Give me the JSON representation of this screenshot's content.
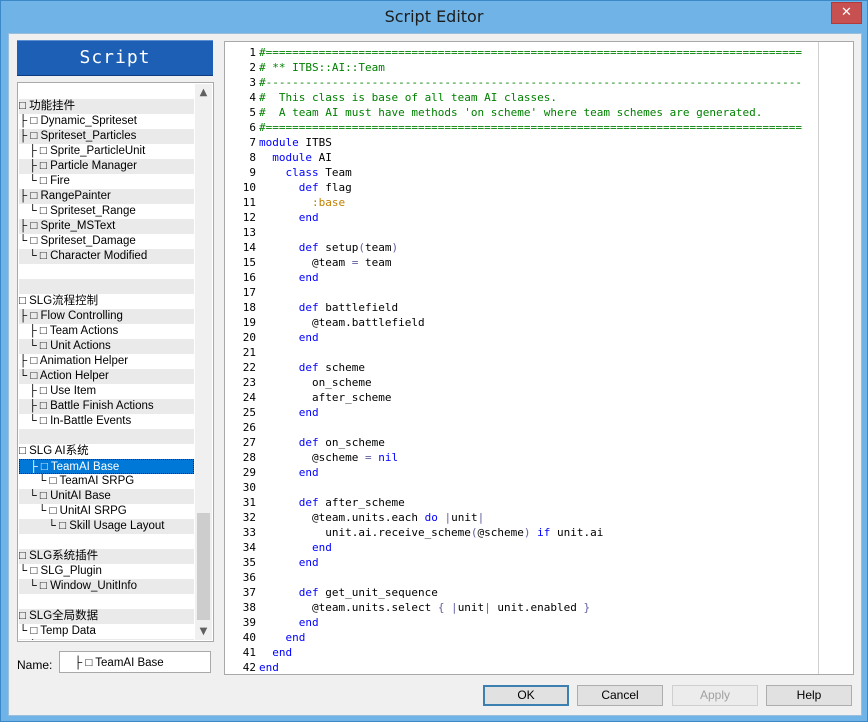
{
  "window": {
    "title": "Script Editor",
    "close_glyph": "✕"
  },
  "header": "Script",
  "script_list": [
    {
      "text": "",
      "shade": false
    },
    {
      "text": "□ 功能挂件",
      "shade": true
    },
    {
      "text": "├ □ Dynamic_Spriteset",
      "shade": false
    },
    {
      "text": "├ □ Spriteset_Particles",
      "shade": true
    },
    {
      "text": "   ├ □ Sprite_ParticleUnit",
      "shade": false
    },
    {
      "text": "   ├ □ Particle Manager",
      "shade": true
    },
    {
      "text": "   └ □ Fire",
      "shade": false
    },
    {
      "text": "├ □ RangePainter",
      "shade": true
    },
    {
      "text": "   └ □ Spriteset_Range",
      "shade": false
    },
    {
      "text": "├ □ Sprite_MSText",
      "shade": true
    },
    {
      "text": "└ □ Spriteset_Damage",
      "shade": false
    },
    {
      "text": "   └ □ Character Modified",
      "shade": true
    },
    {
      "text": "",
      "shade": false
    },
    {
      "text": "",
      "shade": true
    },
    {
      "text": "□ SLG流程控制",
      "shade": false
    },
    {
      "text": "├ □ Flow Controlling",
      "shade": true
    },
    {
      "text": "   ├ □ Team Actions",
      "shade": false
    },
    {
      "text": "   └ □ Unit Actions",
      "shade": true
    },
    {
      "text": "├ □ Animation Helper",
      "shade": false
    },
    {
      "text": "└ □ Action Helper",
      "shade": true
    },
    {
      "text": "   ├ □ Use Item",
      "shade": false
    },
    {
      "text": "   ├ □ Battle Finish Actions",
      "shade": true
    },
    {
      "text": "   └ □ In-Battle Events",
      "shade": false
    },
    {
      "text": "",
      "shade": true
    },
    {
      "text": "□ SLG AI系统",
      "shade": false
    },
    {
      "text": "   ├ □ TeamAI Base",
      "shade": true,
      "selected": true
    },
    {
      "text": "      └ □ TeamAI SRPG",
      "shade": false
    },
    {
      "text": "   └ □ UnitAI Base",
      "shade": true
    },
    {
      "text": "      └ □ UnitAI SRPG",
      "shade": false
    },
    {
      "text": "         └ □ Skill Usage Layout",
      "shade": true
    },
    {
      "text": "",
      "shade": false
    },
    {
      "text": "□ SLG系统插件",
      "shade": true
    },
    {
      "text": "└ □ SLG_Plugin",
      "shade": false
    },
    {
      "text": "   └ □ Window_UnitInfo",
      "shade": true
    },
    {
      "text": "",
      "shade": false
    },
    {
      "text": "□ SLG全局数据",
      "shade": true
    },
    {
      "text": "└ □ Temp Data",
      "shade": false
    },
    {
      "text": "   └ □ Save Data",
      "shade": true
    }
  ],
  "name_label": "Name:",
  "name_value": "├ □ TeamAI Base",
  "code_lines": [
    [
      {
        "t": "#=================================================================================",
        "c": "comment"
      }
    ],
    [
      {
        "t": "# ** ITBS::AI::Team",
        "c": "comment"
      }
    ],
    [
      {
        "t": "#---------------------------------------------------------------------------------",
        "c": "comment"
      }
    ],
    [
      {
        "t": "#  This class is base of all team AI classes.",
        "c": "comment"
      }
    ],
    [
      {
        "t": "#  A team AI must have methods 'on scheme' where team schemes are generated.",
        "c": "comment"
      }
    ],
    [
      {
        "t": "#=================================================================================",
        "c": "comment"
      }
    ],
    [
      {
        "t": "module",
        "c": "kw"
      },
      {
        "t": " ITBS",
        "c": ""
      }
    ],
    [
      {
        "t": "  module",
        "c": "kw"
      },
      {
        "t": " AI",
        "c": ""
      }
    ],
    [
      {
        "t": "    class",
        "c": "kw"
      },
      {
        "t": " Team",
        "c": ""
      }
    ],
    [
      {
        "t": "      def",
        "c": "kw"
      },
      {
        "t": " flag",
        "c": ""
      }
    ],
    [
      {
        "t": "        :base",
        "c": "sym"
      }
    ],
    [
      {
        "t": "      end",
        "c": "kw"
      }
    ],
    [],
    [
      {
        "t": "      def",
        "c": "kw"
      },
      {
        "t": " setup",
        "c": ""
      },
      {
        "t": "(",
        "c": "num"
      },
      {
        "t": "team",
        "c": ""
      },
      {
        "t": ")",
        "c": "num"
      }
    ],
    [
      {
        "t": "        @team ",
        "c": ""
      },
      {
        "t": "=",
        "c": "num"
      },
      {
        "t": " team",
        "c": ""
      }
    ],
    [
      {
        "t": "      end",
        "c": "kw"
      }
    ],
    [],
    [
      {
        "t": "      def",
        "c": "kw"
      },
      {
        "t": " battlefield",
        "c": ""
      }
    ],
    [
      {
        "t": "        @team.battlefield",
        "c": ""
      }
    ],
    [
      {
        "t": "      end",
        "c": "kw"
      }
    ],
    [],
    [
      {
        "t": "      def",
        "c": "kw"
      },
      {
        "t": " scheme",
        "c": ""
      }
    ],
    [
      {
        "t": "        on_scheme",
        "c": ""
      }
    ],
    [
      {
        "t": "        after_scheme",
        "c": ""
      }
    ],
    [
      {
        "t": "      end",
        "c": "kw"
      }
    ],
    [],
    [
      {
        "t": "      def",
        "c": "kw"
      },
      {
        "t": " on_scheme",
        "c": ""
      }
    ],
    [
      {
        "t": "        @scheme ",
        "c": ""
      },
      {
        "t": "=",
        "c": "num"
      },
      {
        "t": " nil",
        "c": "kw"
      }
    ],
    [
      {
        "t": "      end",
        "c": "kw"
      }
    ],
    [],
    [
      {
        "t": "      def",
        "c": "kw"
      },
      {
        "t": " after_scheme",
        "c": ""
      }
    ],
    [
      {
        "t": "        @team.units.each ",
        "c": ""
      },
      {
        "t": "do",
        "c": "kw"
      },
      {
        "t": " |",
        "c": "num"
      },
      {
        "t": "unit",
        "c": ""
      },
      {
        "t": "|",
        "c": "num"
      }
    ],
    [
      {
        "t": "          unit.ai.receive_scheme",
        "c": ""
      },
      {
        "t": "(",
        "c": "num"
      },
      {
        "t": "@scheme",
        "c": ""
      },
      {
        "t": ")",
        "c": "num"
      },
      {
        "t": " if",
        "c": "kw"
      },
      {
        "t": " unit.ai",
        "c": ""
      }
    ],
    [
      {
        "t": "        end",
        "c": "kw"
      }
    ],
    [
      {
        "t": "      end",
        "c": "kw"
      }
    ],
    [],
    [
      {
        "t": "      def",
        "c": "kw"
      },
      {
        "t": " get_unit_sequence",
        "c": ""
      }
    ],
    [
      {
        "t": "        @team.units.select ",
        "c": ""
      },
      {
        "t": "{ |",
        "c": "num"
      },
      {
        "t": "unit",
        "c": ""
      },
      {
        "t": "|",
        "c": "num"
      },
      {
        "t": " unit.enabled ",
        "c": ""
      },
      {
        "t": "}",
        "c": "num"
      }
    ],
    [
      {
        "t": "      end",
        "c": "kw"
      }
    ],
    [
      {
        "t": "    end",
        "c": "kw"
      }
    ],
    [
      {
        "t": "  end",
        "c": "kw"
      }
    ],
    [
      {
        "t": "end",
        "c": "kw"
      }
    ]
  ],
  "buttons": {
    "ok": "OK",
    "cancel": "Cancel",
    "apply": "Apply",
    "help": "Help"
  }
}
